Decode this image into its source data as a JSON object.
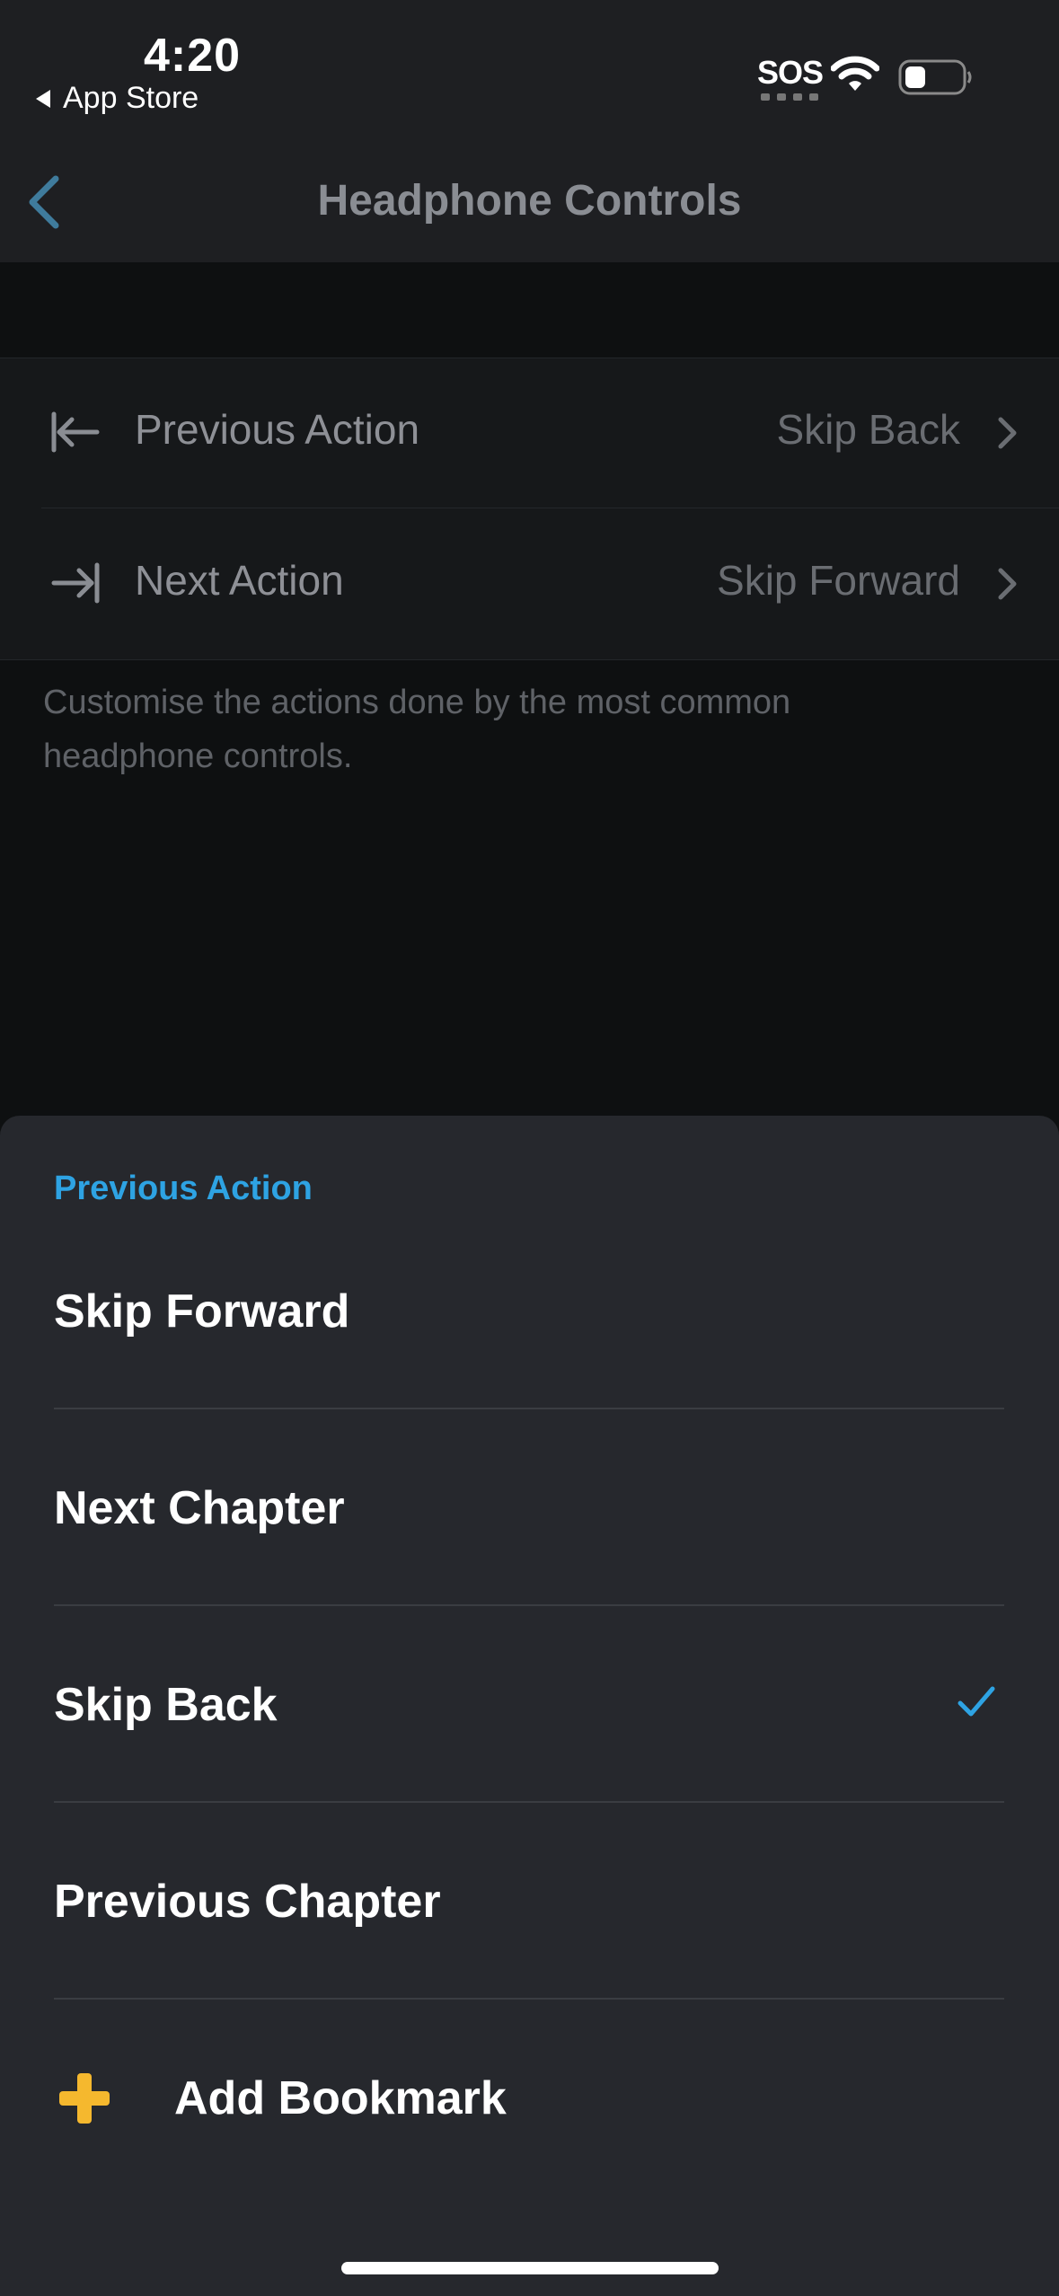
{
  "status_bar": {
    "time": "4:20",
    "back_app": "App Store",
    "sos": "SOS"
  },
  "nav": {
    "title": "Headphone Controls"
  },
  "settings": {
    "rows": [
      {
        "label": "Previous Action",
        "value": "Skip Back",
        "icon": "arrow-left-to-bar-icon"
      },
      {
        "label": "Next Action",
        "value": "Skip Forward",
        "icon": "arrow-right-to-bar-icon"
      }
    ],
    "footer": "Customise the actions done by the most common headphone controls."
  },
  "sheet": {
    "title": "Previous Action",
    "options": [
      {
        "label": "Skip Forward",
        "selected": false
      },
      {
        "label": "Next Chapter",
        "selected": false
      },
      {
        "label": "Skip Back",
        "selected": true
      },
      {
        "label": "Previous Chapter",
        "selected": false
      },
      {
        "label": "Add Bookmark",
        "selected": false,
        "icon": "plus-icon"
      }
    ]
  },
  "colors": {
    "accent": "#2ea3e3",
    "plus": "#f5b82e"
  }
}
